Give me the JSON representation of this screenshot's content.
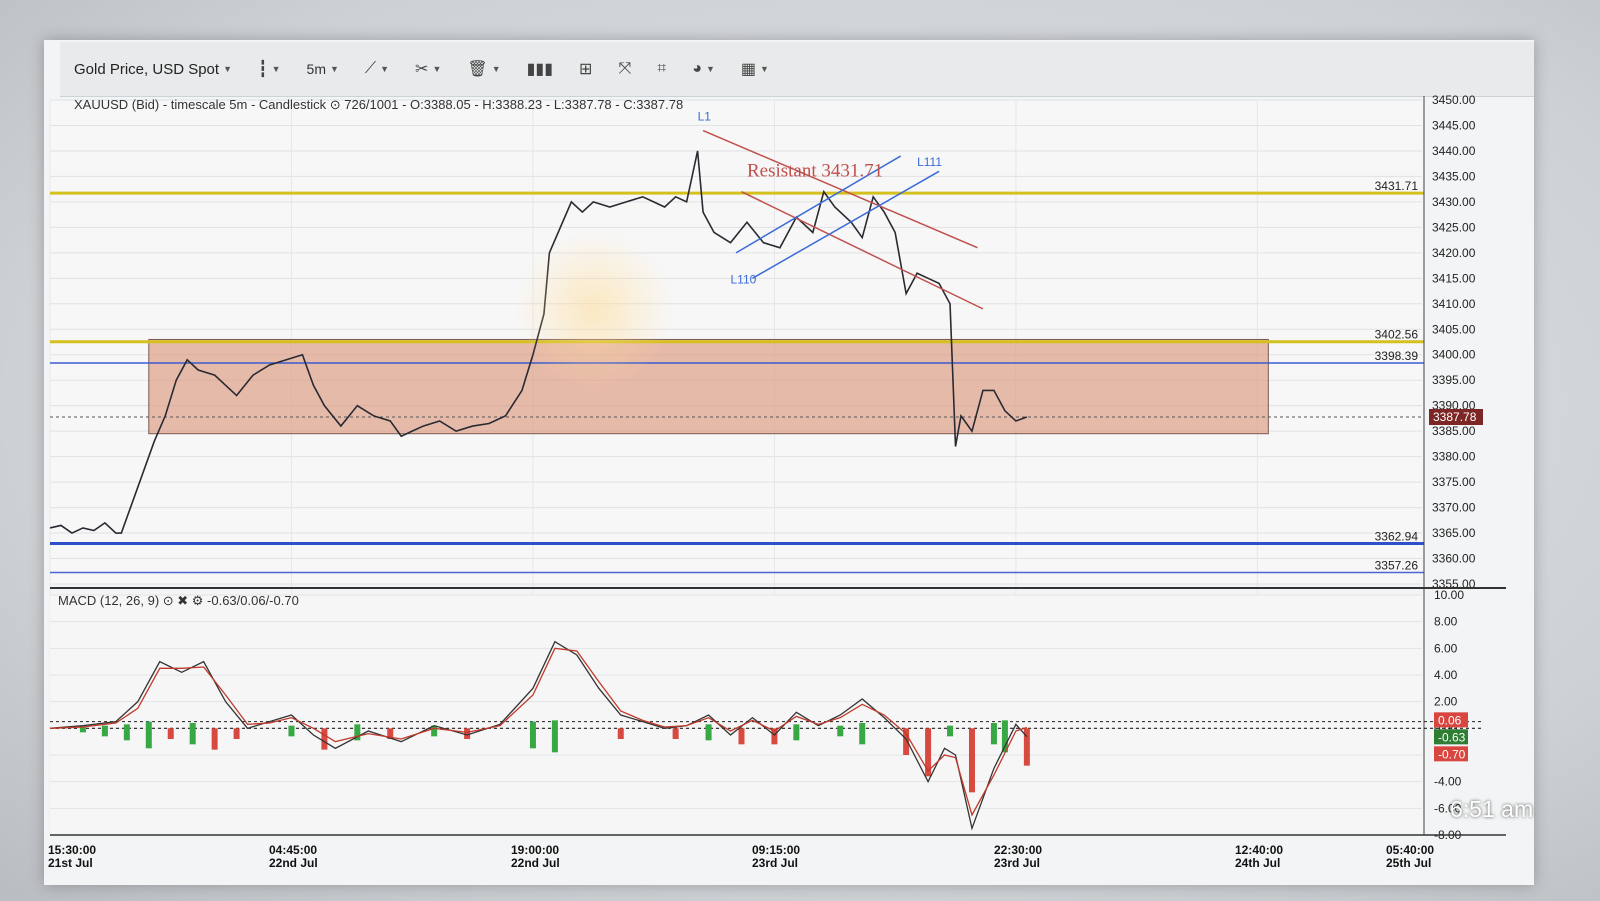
{
  "toolbar": {
    "symbol": "Gold Price, USD Spot",
    "timeframe": "5m",
    "icons": [
      "candlestick-icon",
      "timeframe-icon",
      "draw-line-icon",
      "crosshair-icon",
      "trash-icon",
      "bar-chart-icon",
      "layout-icon",
      "fullscreen-icon",
      "frame-icon",
      "theme-icon",
      "flag-icon"
    ]
  },
  "header": {
    "info": "XAUUSD (Bid) - timescale 5m - Candlestick",
    "ohlc": "726/1001 - O:3388.05 - H:3388.23 - L:3387.78 - C:3387.78"
  },
  "macd_panel": {
    "title": "MACD (12, 26, 9)",
    "values": "-0.63/0.06/-0.70",
    "tags": [
      "0.06",
      "-0.63",
      "-0.70"
    ],
    "colors": {
      "tag1": "#d9463f",
      "tag2": "#2e7d32",
      "tag3": "#d9463f"
    }
  },
  "price_tag": "3387.78",
  "clock": "6:51 am",
  "annotations": {
    "resistance_label": "Resistant 3431.71",
    "line_labels": [
      "L1",
      "L110",
      "L111"
    ],
    "level_labels": [
      "3431.71",
      "3402.56",
      "3398.39",
      "3362.94",
      "3357.26"
    ]
  },
  "chart_data": [
    {
      "type": "line",
      "title": "XAUUSD (Bid) - timescale 5m - Candlestick",
      "x_tick_labels": [
        {
          "time": "15:30:00",
          "date": "21st Jul"
        },
        {
          "time": "04:45:00",
          "date": "22nd Jul"
        },
        {
          "time": "19:00:00",
          "date": "22nd Jul"
        },
        {
          "time": "09:15:00",
          "date": "23rd Jul"
        },
        {
          "time": "22:30:00",
          "date": "23rd Jul"
        },
        {
          "time": "12:40:00",
          "date": "24th Jul"
        },
        {
          "time": "05:40:00",
          "date": "25th Jul"
        }
      ],
      "y_ticks": [
        3355,
        3360,
        3365,
        3370,
        3375,
        3380,
        3385,
        3390,
        3395,
        3400,
        3405,
        3410,
        3415,
        3420,
        3425,
        3430,
        3435,
        3440,
        3445,
        3450
      ],
      "ylim": [
        3355,
        3450
      ],
      "price_points": [
        [
          0,
          3366
        ],
        [
          2,
          3366.5
        ],
        [
          4,
          3365
        ],
        [
          6,
          3366
        ],
        [
          8,
          3365.5
        ],
        [
          10,
          3367
        ],
        [
          12,
          3365
        ],
        [
          13,
          3365
        ],
        [
          16,
          3374
        ],
        [
          19,
          3383
        ],
        [
          21,
          3388
        ],
        [
          23,
          3395
        ],
        [
          25,
          3399
        ],
        [
          27,
          3397
        ],
        [
          30,
          3396
        ],
        [
          32,
          3394
        ],
        [
          34,
          3392
        ],
        [
          37,
          3396
        ],
        [
          40,
          3398
        ],
        [
          43,
          3399
        ],
        [
          46,
          3400
        ],
        [
          48,
          3394
        ],
        [
          50,
          3390
        ],
        [
          53,
          3386
        ],
        [
          56,
          3390
        ],
        [
          59,
          3388
        ],
        [
          62,
          3387
        ],
        [
          64,
          3384
        ],
        [
          66,
          3385
        ],
        [
          68,
          3386
        ],
        [
          71,
          3387
        ],
        [
          74,
          3385
        ],
        [
          77,
          3386
        ],
        [
          80,
          3386.5
        ],
        [
          83,
          3388
        ],
        [
          86,
          3393
        ],
        [
          88,
          3400
        ],
        [
          90,
          3408
        ],
        [
          91,
          3420
        ],
        [
          93,
          3425
        ],
        [
          95,
          3430
        ],
        [
          97,
          3428
        ],
        [
          99,
          3430
        ],
        [
          102,
          3429
        ],
        [
          105,
          3430
        ],
        [
          108,
          3431
        ],
        [
          110,
          3430
        ],
        [
          112,
          3429
        ],
        [
          114,
          3431
        ],
        [
          116,
          3430
        ],
        [
          118,
          3440
        ],
        [
          119,
          3428
        ],
        [
          121,
          3424
        ],
        [
          124,
          3422
        ],
        [
          127,
          3426
        ],
        [
          130,
          3422
        ],
        [
          133,
          3421
        ],
        [
          136,
          3427
        ],
        [
          139,
          3424
        ],
        [
          141,
          3432
        ],
        [
          143,
          3429
        ],
        [
          146,
          3426
        ],
        [
          148,
          3423
        ],
        [
          150,
          3431
        ],
        [
          152,
          3428
        ],
        [
          154,
          3424
        ],
        [
          156,
          3412
        ],
        [
          158,
          3416
        ],
        [
          160,
          3415
        ],
        [
          162,
          3414
        ],
        [
          164,
          3410
        ],
        [
          165,
          3382
        ],
        [
          166,
          3388
        ],
        [
          168,
          3385
        ],
        [
          170,
          3393
        ],
        [
          172,
          3393
        ],
        [
          174,
          3389
        ],
        [
          176,
          3387
        ],
        [
          178,
          3387.78
        ]
      ],
      "levels": [
        {
          "value": 3431.71,
          "color": "#d4c11e",
          "label": "3431.71"
        },
        {
          "value": 3402.56,
          "color": "#d4c11e",
          "label": "3402.56"
        },
        {
          "value": 3398.39,
          "color": "#3a5bd0",
          "label": "3398.39"
        },
        {
          "value": 3362.94,
          "color": "#2d4fc9",
          "label": "3362.94"
        },
        {
          "value": 3357.26,
          "color": "#4a66cf",
          "label": "3357.26"
        }
      ],
      "zone": {
        "from_x": 18,
        "to_x": 222,
        "low": 3384.5,
        "high": 3403,
        "color": "#d9896a"
      },
      "last_price": 3387.78
    },
    {
      "type": "line",
      "title": "MACD (12, 26, 9)",
      "y_ticks": [
        -8,
        -6,
        -4,
        -2,
        0,
        2,
        4,
        6,
        8,
        10
      ],
      "y_tick_labels": [
        "-8.00",
        "-6.00",
        "-4.00",
        "-2.00",
        "0.00",
        "2.00",
        "4.00",
        "6.00",
        "8.00",
        "10.00"
      ],
      "ylim": [
        -8,
        10
      ],
      "series": [
        {
          "name": "MACD",
          "color": "#333333",
          "values": [
            [
              0,
              0
            ],
            [
              6,
              0.2
            ],
            [
              12,
              0.5
            ],
            [
              16,
              2
            ],
            [
              20,
              5
            ],
            [
              24,
              4.2
            ],
            [
              28,
              5
            ],
            [
              32,
              2
            ],
            [
              36,
              0
            ],
            [
              40,
              0.5
            ],
            [
              44,
              1
            ],
            [
              48,
              -0.5
            ],
            [
              52,
              -1.5
            ],
            [
              58,
              -0.2
            ],
            [
              64,
              -1
            ],
            [
              70,
              0.2
            ],
            [
              76,
              -0.5
            ],
            [
              82,
              0.3
            ],
            [
              88,
              3
            ],
            [
              92,
              6.5
            ],
            [
              96,
              5.5
            ],
            [
              100,
              3
            ],
            [
              104,
              1
            ],
            [
              108,
              0.5
            ],
            [
              112,
              0
            ],
            [
              116,
              0.2
            ],
            [
              120,
              1
            ],
            [
              124,
              -0.5
            ],
            [
              128,
              0.8
            ],
            [
              132,
              -0.5
            ],
            [
              136,
              1.2
            ],
            [
              140,
              0.2
            ],
            [
              144,
              1
            ],
            [
              148,
              2.2
            ],
            [
              152,
              0.8
            ],
            [
              156,
              -0.8
            ],
            [
              160,
              -4
            ],
            [
              163,
              -1.5
            ],
            [
              165,
              -2
            ],
            [
              168,
              -7.5
            ],
            [
              172,
              -3
            ],
            [
              176,
              0.3
            ],
            [
              178,
              -0.63
            ]
          ]
        },
        {
          "name": "Signal",
          "color": "#c0392b",
          "values": [
            [
              0,
              0
            ],
            [
              6,
              0.1
            ],
            [
              12,
              0.4
            ],
            [
              16,
              1.5
            ],
            [
              20,
              4.5
            ],
            [
              24,
              4.5
            ],
            [
              28,
              4.6
            ],
            [
              32,
              2.5
            ],
            [
              36,
              0.3
            ],
            [
              40,
              0.4
            ],
            [
              44,
              0.8
            ],
            [
              48,
              0
            ],
            [
              52,
              -1
            ],
            [
              58,
              -0.4
            ],
            [
              64,
              -0.8
            ],
            [
              70,
              0
            ],
            [
              76,
              -0.3
            ],
            [
              82,
              0.2
            ],
            [
              88,
              2.5
            ],
            [
              92,
              6
            ],
            [
              96,
              5.8
            ],
            [
              100,
              3.5
            ],
            [
              104,
              1.3
            ],
            [
              108,
              0.6
            ],
            [
              112,
              0.1
            ],
            [
              116,
              0.2
            ],
            [
              120,
              0.8
            ],
            [
              124,
              -0.2
            ],
            [
              128,
              0.6
            ],
            [
              132,
              -0.2
            ],
            [
              136,
              0.9
            ],
            [
              140,
              0.3
            ],
            [
              144,
              0.8
            ],
            [
              148,
              1.8
            ],
            [
              152,
              1
            ],
            [
              156,
              -0.4
            ],
            [
              160,
              -3.2
            ],
            [
              163,
              -2
            ],
            [
              165,
              -2.2
            ],
            [
              168,
              -6.5
            ],
            [
              172,
              -3.5
            ],
            [
              176,
              -0.2
            ],
            [
              178,
              0.06
            ]
          ]
        },
        {
          "name": "Histogram",
          "color": "#2e9e3f",
          "values": [
            [
              6,
              0.1
            ],
            [
              10,
              0.2
            ],
            [
              14,
              0.3
            ],
            [
              18,
              0.5
            ],
            [
              22,
              -0.2
            ],
            [
              26,
              0.4
            ],
            [
              30,
              -0.4
            ],
            [
              34,
              -0.2
            ],
            [
              44,
              0.2
            ],
            [
              50,
              -0.4
            ],
            [
              56,
              0.3
            ],
            [
              62,
              -0.2
            ],
            [
              70,
              0.2
            ],
            [
              76,
              -0.2
            ],
            [
              88,
              0.5
            ],
            [
              92,
              0.6
            ],
            [
              104,
              -0.2
            ],
            [
              114,
              -0.2
            ],
            [
              120,
              0.3
            ],
            [
              126,
              -0.3
            ],
            [
              132,
              -0.3
            ],
            [
              136,
              0.3
            ],
            [
              144,
              0.2
            ],
            [
              148,
              0.4
            ],
            [
              156,
              -0.5
            ],
            [
              160,
              -0.9
            ],
            [
              164,
              0.2
            ],
            [
              168,
              -1.2
            ],
            [
              172,
              0.4
            ],
            [
              174,
              0.6
            ],
            [
              178,
              -0.7
            ]
          ]
        }
      ]
    }
  ]
}
